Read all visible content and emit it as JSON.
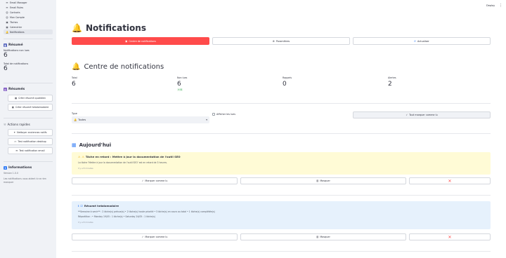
{
  "sidebar": {
    "nav": [
      {
        "icon": "✉",
        "label": "Email Manager"
      },
      {
        "icon": "✉",
        "label": "Email Rules"
      },
      {
        "icon": "☺",
        "label": "Contacts"
      },
      {
        "icon": "☺",
        "label": "Mon Compte"
      },
      {
        "icon": "▣",
        "label": "Tâches"
      },
      {
        "icon": "▦",
        "label": "Calendrier"
      },
      {
        "icon": "🔔",
        "label": "Notifications"
      }
    ],
    "summary_title": "Résumé",
    "unread_label": "Notifications non lues",
    "unread_value": "6",
    "total_label": "Total de notifications",
    "total_value": "6",
    "digests_title": "Résumés",
    "daily_digest_label": "Créer résumé quotidien",
    "weekly_digest_label": "Créer résumé hebdomadaire",
    "quick_actions_title": "Actions rapides",
    "cleanup_label": "Nettoyer anciennes notifs",
    "desktop_test_label": "Test notification desktop",
    "email_test_label": "Test notification email",
    "info_title": "Informations",
    "version": "Version 1.0.0",
    "info_text": "Les notifications vous aident à ne rien manquer"
  },
  "header": {
    "deploy_label": "Deploy",
    "menu_icon": "⋮"
  },
  "page": {
    "title": "Notifications",
    "title_icon": "🔔",
    "tabs": {
      "center": "Centre de notifications",
      "settings": "Paramètres",
      "refresh": "Actualiser"
    }
  },
  "center": {
    "title": "Centre de notifications",
    "metrics": [
      {
        "label": "Total",
        "value": "6"
      },
      {
        "label": "Non lues",
        "value": "6",
        "delta": "+ 6"
      },
      {
        "label": "Rappels",
        "value": "0"
      },
      {
        "label": "Alertes",
        "value": "2"
      }
    ],
    "type_label": "Type",
    "type_selected": "Toutes",
    "show_read_label": "Afficher les lues",
    "mark_all_label": "Tout marquer comme lu"
  },
  "today": {
    "title": "Aujourd'hui",
    "notifications": [
      {
        "title": "Tâche en retard : Mettre à jour la documentation de l'outil SEO",
        "line": "La tâche 'Mettre à jour la documentation de l'outil SEO' est en retard de 3 heures.",
        "time": "Il y a 8 minutes",
        "mark_read": "Marquer comme lu",
        "snooze": "Masquer"
      },
      {
        "title": "Résumé hebdomadaire",
        "line": "**Semaine à venir** : 2 tâche(s) prévue(s) • 2 tâche(s) haute priorité • 3 tâche(s) en cours au total • 1 tâche(s) complétée(s)",
        "line2": "Répartition : • Monday 19/05 : 1 tâche(s) • Saturday 24/05 : 1 tâche(s)",
        "time": "Il y a 8 minutes",
        "mark_read": "Marquer comme lu",
        "snooze": "Masquer"
      }
    ]
  },
  "colors": {
    "accent": "#ff4b4b",
    "warning_bg": "#fffbd6",
    "info_bg": "#e6f1fc",
    "sidebar_bg": "#f0f2f6"
  }
}
